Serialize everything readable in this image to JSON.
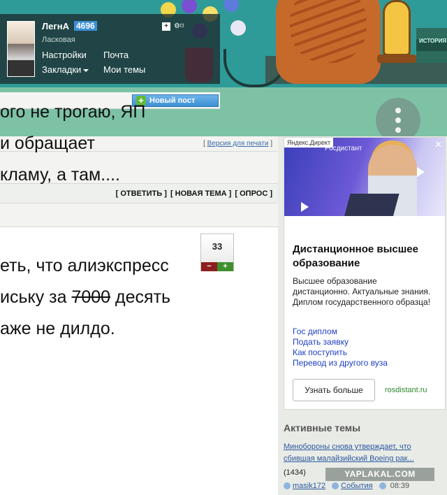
{
  "user": {
    "name": "ЛегнА",
    "reputation": "4696",
    "rank": "Ласковая",
    "links": {
      "settings": "Настройки",
      "mail": "Почта",
      "bookmarks": "Закладки",
      "my_topics": "Мои темы"
    }
  },
  "toolbar": {
    "new_post": "Новый пост"
  },
  "topic": {
    "print_prefix": "[ ",
    "print_link": "Версия для печати",
    "print_suffix": " ]",
    "actions": [
      "[ ОТВЕТИТЬ ]",
      "[ НОВАЯ ТЕМА ]",
      "[ ОПРОС ]"
    ]
  },
  "post": {
    "lines": [
      "ого не трогаю, ЯП",
      "и обращает",
      "кламу, а там....",
      "еть, что алиэкспресс",
      "иську за ",
      "аже не дилдо."
    ],
    "strike_number": "7000",
    "line5_tail": " десять",
    "rating": "33",
    "rate_minus": "−",
    "rate_plus": "+"
  },
  "ad": {
    "label": "Яндекс.Директ",
    "logo": "Росдистант",
    "title": "Дистанционное высшее образование",
    "description": "Высшее образование дистанционно. Актуальные знания. Диплом государственного образца!",
    "links": [
      "Гос диплом",
      "Подать заявку",
      "Как поступить",
      "Перевод из другого вуза"
    ],
    "button": "Узнать больше",
    "domain": "rosdistant.ru",
    "close": "✕"
  },
  "active_topics": {
    "title": "Активные темы",
    "items": [
      {
        "title": "Минобороны снова утверждает, что сбившая малайзийский Boeing рак...",
        "count": "(1434)",
        "author": "masik172",
        "category": "События",
        "time": "08:39"
      }
    ]
  },
  "banner": {
    "book_text": "ИСТОРИЯ"
  },
  "watermark": "YAPLAKAL.COM",
  "colors": {
    "accent_blue": "#3d8fd6",
    "new_post_blue": "#3b8fd3",
    "link_blue": "#2a58a0",
    "minus_red": "#8c1f1f",
    "plus_green": "#3f8f2d",
    "banner_teal": "#2f9b98"
  }
}
